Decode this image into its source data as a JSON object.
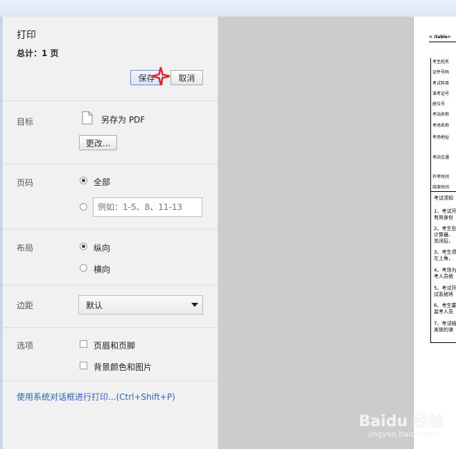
{
  "sidebar": {
    "title": "打印",
    "total": "总计：1 页",
    "save_label": "保存",
    "cancel_label": "取消",
    "destination": {
      "label": "目标",
      "name": "另存为 PDF",
      "change_label": "更改..."
    },
    "pages": {
      "label": "页码",
      "all_label": "全部",
      "custom_placeholder": "例如：1-5、8、11-13"
    },
    "layout": {
      "label": "布局",
      "portrait_label": "纵向",
      "landscape_label": "横向"
    },
    "margins": {
      "label": "边距",
      "selected": "默认"
    },
    "options": {
      "label": "选项",
      "headers_label": "页眉和页脚",
      "background_label": "背景颜色和图片"
    },
    "system_dialog_link": "使用系统对话框进行打印...(Ctrl+Shift+P)"
  },
  "preview": {
    "table_tag": "< /table>",
    "fields": [
      "考生姓名",
      "证件号码",
      "考试科目",
      "准考证号",
      "座位号",
      "考站名称",
      "考场名称",
      "考场地址",
      "考站交通",
      "开考时间",
      "结束时间"
    ],
    "notice_title": "考试须知",
    "notice_lines": [
      "1、考试开",
      "有效身份",
      "2、考生在",
      "计算器、",
      "关闭后，",
      "3、考生须",
      "左上角，",
      "4、考场为",
      "考人员统",
      "5、考试开",
      "试系统将",
      "6、考生要",
      "监考人员",
      "7、考试结",
      "发放的演"
    ]
  },
  "watermark": {
    "brand": "Baidu 经验",
    "url": "jingyan.baidu.com"
  },
  "colors": {
    "accent": "#2a62c9",
    "star": "#e8212b"
  }
}
